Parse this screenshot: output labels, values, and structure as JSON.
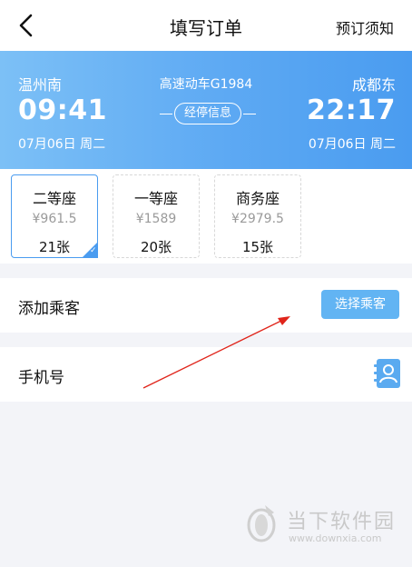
{
  "header": {
    "title": "填写订单",
    "notice_label": "预订须知"
  },
  "train": {
    "from_station": "温州南",
    "to_station": "成都东",
    "depart_time": "09:41",
    "arrive_time": "22:17",
    "depart_date": "07月06日 周二",
    "arrive_date": "07月06日 周二",
    "train_label": "高速动车G1984",
    "stops_label": "经停信息"
  },
  "seats": [
    {
      "name": "二等座",
      "price": "¥961.5",
      "count": "21张",
      "selected": true
    },
    {
      "name": "一等座",
      "price": "¥1589",
      "count": "20张",
      "selected": false
    },
    {
      "name": "商务座",
      "price": "¥2979.5",
      "count": "15张",
      "selected": false
    }
  ],
  "passenger": {
    "label": "添加乘客",
    "button_label": "选择乘客"
  },
  "phone": {
    "label": "手机号",
    "icon": "contact-book-icon"
  },
  "watermark": {
    "name": "当下软件园",
    "url": "www.downxia.com"
  },
  "colors": {
    "banner_start": "#7cc0f6",
    "banner_end": "#4a9cf0",
    "accent": "#4a9cf0",
    "annotation_arrow": "#e0251b"
  }
}
